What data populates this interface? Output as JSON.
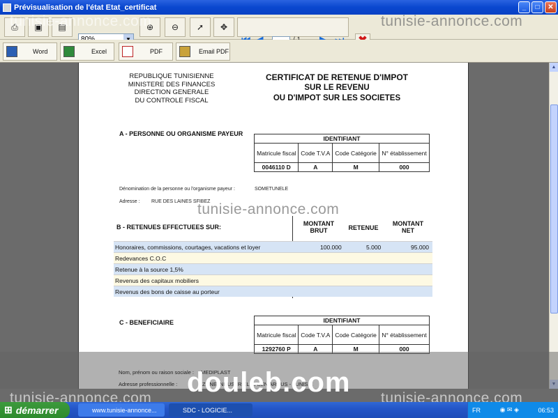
{
  "window": {
    "title": "Prévisualisation de l'état Etat_certificat",
    "btn_minimize": "_",
    "btn_maximize": "□",
    "btn_close": "✕"
  },
  "toolbar": {
    "zoom_value": "80%",
    "zoom_dropdown": "▼",
    "page_of": "/ 1",
    "first": "⏮",
    "prev": "◀",
    "next": "▶",
    "last": "⏭",
    "close_symbol": "✖"
  },
  "export": {
    "word": "Word",
    "excel": "Excel",
    "pdf": "PDF",
    "email_pdf": "Email PDF"
  },
  "document": {
    "org_lines": [
      "REPUBLIQUE TUNISIENNE",
      "MINISTERE DES FINANCES",
      "DIRECTION GENERALE",
      "DU CONTROLE FISCAL"
    ],
    "cert_lines": [
      "CERTIFICAT DE RETENUE D'IMPOT",
      "SUR LE REVENU",
      "OU D'IMPOT SUR LES SOCIETES"
    ],
    "section_a": "A - PERSONNE OU ORGANISME PAYEUR",
    "ident_a": {
      "title": "IDENTIFIANT",
      "headers": [
        "Matricule fiscal",
        "Code T.V.A",
        "Code Catégorie",
        "N° établissement"
      ],
      "values": [
        "0046110 D",
        "A",
        "M",
        "000"
      ]
    },
    "payeur_label": "Dénomination de la personne ou l'organisme payeur :",
    "payeur_value": "SOMETUNELE",
    "adresse_label": "Adresse :",
    "adresse_value": "RUE DES LAINES SFIBEZ",
    "section_b": "B - RETENUES EFFECTUEES SUR:",
    "ret_headers": [
      "MONTANT BRUT",
      "RETENUE",
      "MONTANT NET"
    ],
    "ret_rows": [
      {
        "label": "Honoraires, commissions, courtages, vacations et loyer",
        "brut": "100.000",
        "retenue": "5.000",
        "net": "95.000"
      },
      {
        "label": "Redevances C.O.C",
        "brut": "",
        "retenue": "",
        "net": ""
      },
      {
        "label": "Retenue à la source 1,5%",
        "brut": "",
        "retenue": "",
        "net": ""
      },
      {
        "label": "Revenus des capitaux mobiliers",
        "brut": "",
        "retenue": "",
        "net": ""
      },
      {
        "label": "Revenus des bons de caisse au porteur",
        "brut": "",
        "retenue": "",
        "net": ""
      }
    ],
    "section_c": "C - BENEFICIAIRE",
    "ident_c": {
      "title": "IDENTIFIANT",
      "headers": [
        "Matricule fiscal",
        "Code T.V.A",
        "Code Catégorie",
        "N° établissement"
      ],
      "values": [
        "1292760 P",
        "A",
        "M",
        "000"
      ]
    },
    "benef_label": "Nom, prénom ou raison sociale :",
    "benef_value": "MEDIPLAST",
    "benef_adresse_label": "Adresse professionnelle :",
    "benef_adresse_value": "ZONE INDUSTRIELLE BEN AROUS - TUNISIE"
  },
  "watermarks": {
    "top": "tunisie-annonce.com",
    "top_right": "tunisie-annonce.com",
    "middle": "tunisie-annonce.com",
    "bottom_left": "tunisie-annonce.com",
    "bottom_right": "tunisie-annonce.com",
    "douleb": "douleb.com"
  },
  "taskbar": {
    "start": "démarrer",
    "task1": "www.tunisie-annonce...",
    "task2": "SDC - LOGICIE...",
    "lang": "FR",
    "clock": "06:53"
  }
}
